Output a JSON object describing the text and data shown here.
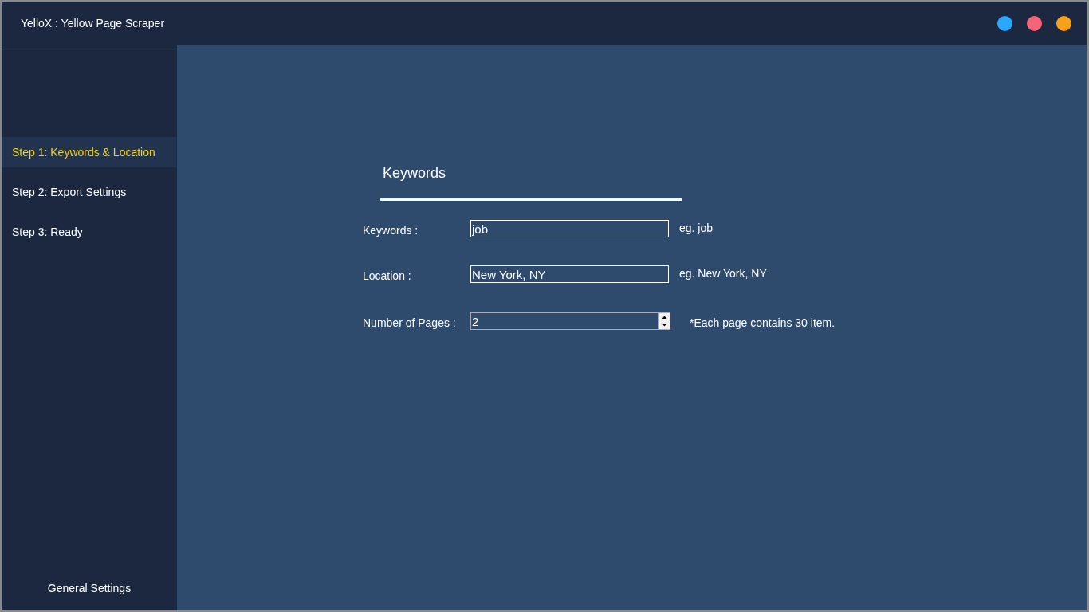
{
  "window": {
    "title": "YelloX : Yellow Page Scraper",
    "controls": [
      {
        "color": "#2aa8ff"
      },
      {
        "color": "#f5657a"
      },
      {
        "color": "#f9a01b"
      }
    ]
  },
  "sidebar": {
    "items": [
      {
        "label": "Step 1: Keywords & Location",
        "selected": true
      },
      {
        "label": "Step 2: Export Settings",
        "selected": false
      },
      {
        "label": "Step 3: Ready",
        "selected": false
      }
    ],
    "footer": "General Settings"
  },
  "form": {
    "heading": "Keywords",
    "fields": [
      {
        "kind": "text",
        "label": "Keywords :",
        "value": "job",
        "hint": "eg. job"
      },
      {
        "kind": "text",
        "label": "Location :",
        "value": "New York, NY",
        "hint": "eg. New York, NY"
      },
      {
        "kind": "number",
        "label": "Number of Pages :",
        "value": "2",
        "hint": "*Each page contains 30 item."
      }
    ]
  }
}
